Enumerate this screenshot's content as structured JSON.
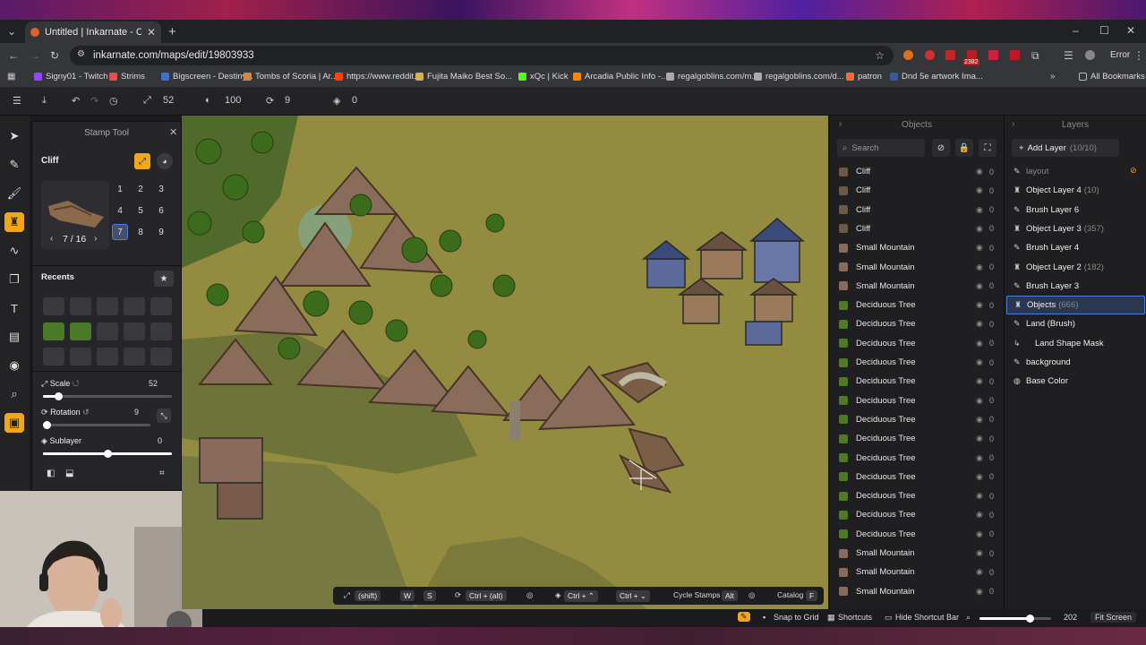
{
  "browser": {
    "tab_title": "Untitled | Inkarnate - Create Fa",
    "url": "inkarnate.com/maps/edit/19803933",
    "error_label": "Error",
    "extension_badge": "2382",
    "bookmarks": [
      "Signy01 - Twitch",
      "Strims",
      "Bigscreen - Destiny...",
      "Tombs of Scoria | Ar...",
      "https://www.reddit....",
      "Fujita Maiko Best So...",
      "xQc | Kick",
      "Arcadia Public Info -...",
      "regalgoblins.com/m...",
      "regalgoblins.com/d...",
      "patron",
      "Dnd 5e artwork Ima..."
    ],
    "all_bookmarks": "All Bookmarks"
  },
  "toolbar": {
    "size": "52",
    "opacity": "100",
    "rotation": "9",
    "layers": "0"
  },
  "stamp": {
    "title": "Stamp Tool",
    "category": "Cliff",
    "pager": "7 / 16",
    "numbers": [
      "1",
      "2",
      "3",
      "4",
      "5",
      "6",
      "7",
      "8",
      "9"
    ],
    "recents_label": "Recents",
    "scale_label": "Scale",
    "scale_value": "52",
    "scale_fraction": 0.12,
    "rotation_label": "Rotation",
    "rotation_value": "9",
    "rotation_fraction": 0.03,
    "sublayer_label": "Sublayer",
    "sublayer_value": "0",
    "sublayer_fraction": 0.5
  },
  "objects": {
    "header": "Objects",
    "search_placeholder": "Search",
    "rows": [
      {
        "name": "Cliff",
        "count": "0",
        "color": "#6b5a46"
      },
      {
        "name": "Cliff",
        "count": "0",
        "color": "#6b5a46"
      },
      {
        "name": "Cliff",
        "count": "0",
        "color": "#6b5a46"
      },
      {
        "name": "Cliff",
        "count": "0",
        "color": "#6b5a46"
      },
      {
        "name": "Small Mountain",
        "count": "0",
        "color": "#8a6a5a"
      },
      {
        "name": "Small Mountain",
        "count": "0",
        "color": "#8a6a5a"
      },
      {
        "name": "Small Mountain",
        "count": "0",
        "color": "#8a6a5a"
      },
      {
        "name": "Deciduous Tree",
        "count": "0",
        "color": "#4e7a24"
      },
      {
        "name": "Deciduous Tree",
        "count": "0",
        "color": "#4e7a24"
      },
      {
        "name": "Deciduous Tree",
        "count": "0",
        "color": "#4e7a24"
      },
      {
        "name": "Deciduous Tree",
        "count": "0",
        "color": "#4e7a24"
      },
      {
        "name": "Deciduous Tree",
        "count": "0",
        "color": "#4e7a24"
      },
      {
        "name": "Deciduous Tree",
        "count": "0",
        "color": "#4e7a24"
      },
      {
        "name": "Deciduous Tree",
        "count": "0",
        "color": "#4e7a24"
      },
      {
        "name": "Deciduous Tree",
        "count": "0",
        "color": "#4e7a24"
      },
      {
        "name": "Deciduous Tree",
        "count": "0",
        "color": "#4e7a24"
      },
      {
        "name": "Deciduous Tree",
        "count": "0",
        "color": "#4e7a24"
      },
      {
        "name": "Deciduous Tree",
        "count": "0",
        "color": "#4e7a24"
      },
      {
        "name": "Deciduous Tree",
        "count": "0",
        "color": "#4e7a24"
      },
      {
        "name": "Deciduous Tree",
        "count": "0",
        "color": "#4e7a24"
      },
      {
        "name": "Small Mountain",
        "count": "0",
        "color": "#8a6a5a"
      },
      {
        "name": "Small Mountain",
        "count": "0",
        "color": "#8a6a5a"
      },
      {
        "name": "Small Mountain",
        "count": "0",
        "color": "#8a6a5a"
      }
    ]
  },
  "layers": {
    "header": "Layers",
    "add_label": "Add Layer",
    "add_count": "(10/10)",
    "rows": [
      {
        "icon": "✎",
        "name": "layout",
        "count": "",
        "dim": true
      },
      {
        "icon": "♜",
        "name": "Object Layer 4",
        "count": "(10)"
      },
      {
        "icon": "✎",
        "name": "Brush Layer 6",
        "count": ""
      },
      {
        "icon": "♜",
        "name": "Object Layer 3",
        "count": "(357)"
      },
      {
        "icon": "✎",
        "name": "Brush Layer 4",
        "count": ""
      },
      {
        "icon": "♜",
        "name": "Object Layer 2",
        "count": "(182)"
      },
      {
        "icon": "✎",
        "name": "Brush Layer 3",
        "count": ""
      },
      {
        "icon": "♜",
        "name": "Objects",
        "count": "(666)",
        "selected": true
      },
      {
        "icon": "✎",
        "name": "Land (Brush)",
        "count": ""
      },
      {
        "icon": "↳",
        "name": "Land Shape Mask",
        "count": ""
      },
      {
        "icon": "✎",
        "name": "background",
        "count": ""
      },
      {
        "icon": "◍",
        "name": "Base Color",
        "count": ""
      }
    ]
  },
  "shortcuts": {
    "shift": "(shift)",
    "w": "W",
    "s": "S",
    "ctrl_alt": "Ctrl + (alt)",
    "ctrl1": "Ctrl + ⌃",
    "ctrl2": "Ctrl + ⌄",
    "cycle": "Cycle Stamps",
    "alt": "Alt",
    "catalog": "Catalog",
    "f": "F"
  },
  "bottom": {
    "snap": "Snap to Grid",
    "shortcuts": "Shortcuts",
    "hide": "Hide Shortcut Bar",
    "zoom": "202",
    "fit": "Fit Screen",
    "zoom_fraction": 0.7
  }
}
